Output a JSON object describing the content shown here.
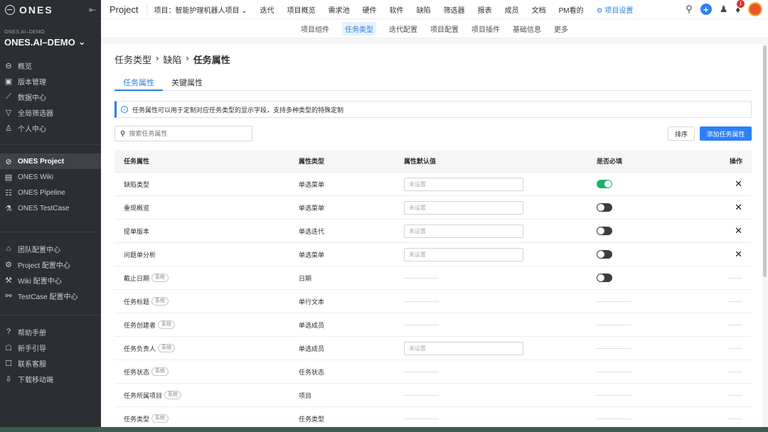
{
  "sidebar": {
    "logo": "ONES",
    "collapse_icon": "⇤",
    "org_small": "ONES.AI–DEMO",
    "org_name": "ONES.AI–DEMO",
    "nav1": [
      {
        "icon": "⊖",
        "label": "概览"
      },
      {
        "icon": "▣",
        "label": "版本管理"
      },
      {
        "icon": "⟋",
        "label": "数据中心"
      },
      {
        "icon": "▽",
        "label": "全局筛选器"
      },
      {
        "icon": "♙",
        "label": "个人中心"
      }
    ],
    "nav2": [
      {
        "icon": "⊘",
        "label": "ONES Project"
      },
      {
        "icon": "▤",
        "label": "ONES Wiki"
      },
      {
        "icon": "☷",
        "label": "ONES Pipeline"
      },
      {
        "icon": "⚗",
        "label": "ONES TestCase"
      }
    ],
    "nav3": [
      {
        "icon": "⌂",
        "label": "团队配置中心"
      },
      {
        "icon": "⚙",
        "label": "Project 配置中心"
      },
      {
        "icon": "⚒",
        "label": "Wiki 配置中心"
      },
      {
        "icon": "⚯",
        "label": "TestCase 配置中心"
      }
    ],
    "nav4": [
      {
        "icon": "?",
        "label": "帮助手册"
      },
      {
        "icon": "☖",
        "label": "新手引导"
      },
      {
        "icon": "☐",
        "label": "联系客服"
      },
      {
        "icon": "⇩",
        "label": "下载移动端"
      }
    ]
  },
  "topbar": {
    "title": "Project",
    "project_selector": "项目：智能护理机器人项目 ⌄",
    "nav": [
      "迭代",
      "项目概览",
      "需求池",
      "硬件",
      "软件",
      "缺陷",
      "筛选器",
      "报表",
      "成员",
      "文档",
      "PM看的",
      "⚙ 项目设置"
    ],
    "notification_count": "1"
  },
  "subnav": [
    "项目组件",
    "任务类型",
    "迭代配置",
    "项目配置",
    "项目插件",
    "基础信息",
    "更多"
  ],
  "breadcrumb": {
    "part1": "任务类型",
    "sep": "›",
    "part2": "缺陷",
    "part3": "任务属性"
  },
  "tabs": [
    "任务属性",
    "关键属性"
  ],
  "info_text": "任务属性可以用于定制对应任务类型的显示字段，支持多种类型的特殊定制",
  "search": {
    "placeholder": "搜索任务属性"
  },
  "buttons": {
    "sort": "排序",
    "add": "添加任务属性"
  },
  "table": {
    "headers": [
      "任务属性",
      "属性类型",
      "属性默认值",
      "是否必填",
      "操作"
    ],
    "system_tag": "系统",
    "default_placeholder": "未设置",
    "rows": [
      {
        "name": "缺陷类型",
        "system": false,
        "type": "单选菜单",
        "default": "input",
        "required": "on",
        "action": "delete"
      },
      {
        "name": "重现概览",
        "system": false,
        "type": "单选菜单",
        "default": "input",
        "required": "off",
        "action": "delete"
      },
      {
        "name": "提单版本",
        "system": false,
        "type": "单选迭代",
        "default": "input",
        "required": "off",
        "action": "delete"
      },
      {
        "name": "问题单分析",
        "system": false,
        "type": "单选菜单",
        "default": "input",
        "required": "off",
        "action": "delete"
      },
      {
        "name": "截止日期",
        "system": true,
        "type": "日期",
        "default": "dash",
        "required": "off",
        "action": "dash"
      },
      {
        "name": "任务标题",
        "system": true,
        "type": "单行文本",
        "default": "dash",
        "required": "dash",
        "action": "dash"
      },
      {
        "name": "任务创建者",
        "system": true,
        "type": "单选成员",
        "default": "dash",
        "required": "dash",
        "action": "dash"
      },
      {
        "name": "任务负责人",
        "system": true,
        "type": "单选成员",
        "default": "input",
        "required": "dash",
        "action": "dash"
      },
      {
        "name": "任务状态",
        "system": true,
        "type": "任务状态",
        "default": "dash",
        "required": "dash",
        "action": "dash"
      },
      {
        "name": "任务所属项目",
        "system": true,
        "type": "项目",
        "default": "dash",
        "required": "dash",
        "action": "dash"
      },
      {
        "name": "任务类型",
        "system": true,
        "type": "任务类型",
        "default": "dash",
        "required": "dash",
        "action": "dash"
      }
    ]
  }
}
